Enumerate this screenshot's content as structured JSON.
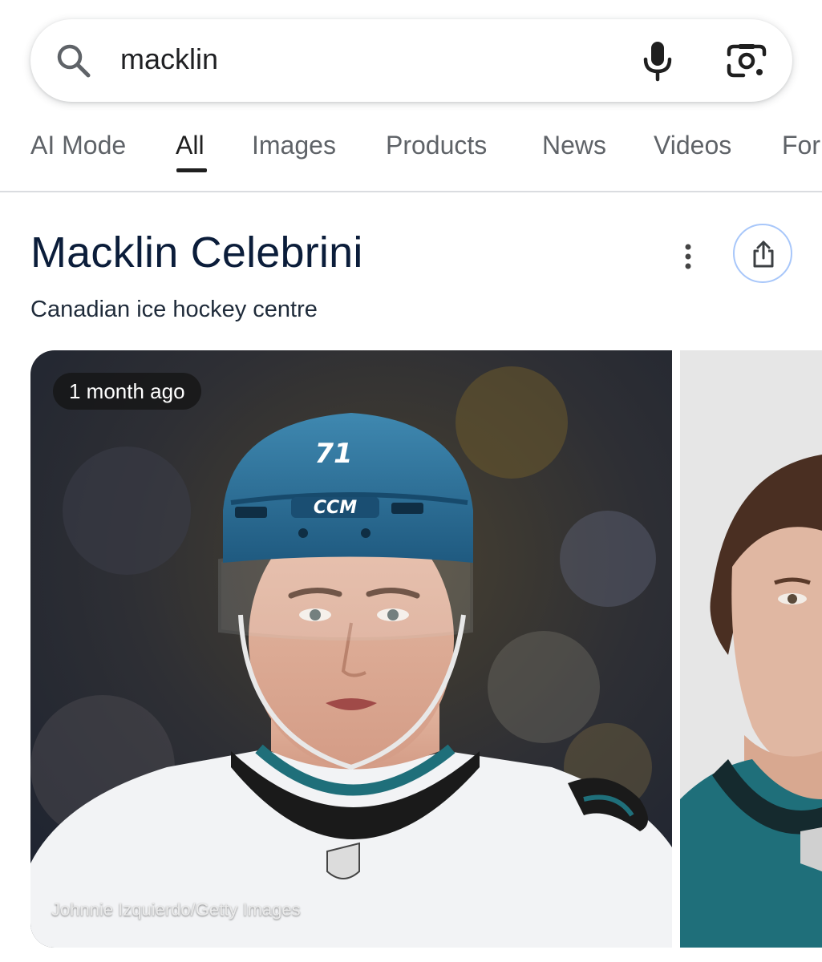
{
  "search": {
    "query": "macklin",
    "icons": [
      "search-icon",
      "mic-icon",
      "google-lens-icon"
    ]
  },
  "tabs": [
    {
      "label": "AI Mode",
      "active": false
    },
    {
      "label": "All",
      "active": true
    },
    {
      "label": "Images",
      "active": false
    },
    {
      "label": "Products",
      "active": false
    },
    {
      "label": "News",
      "active": false
    },
    {
      "label": "Videos",
      "active": false
    },
    {
      "label": "For",
      "active": false
    }
  ],
  "entity": {
    "title": "Macklin Celebrini",
    "subtitle": "Canadian ice hockey centre",
    "icons": [
      "more-vert-icon",
      "share-icon"
    ]
  },
  "images": [
    {
      "time_badge": "1 month ago",
      "credit": "Johnnie Izquierdo/Getty Images",
      "helmet_number": "71",
      "helmet_brand": "CCM"
    },
    {}
  ],
  "colors": {
    "accent_border": "#a8c7fa",
    "title": "#0b1d3a",
    "tab_inactive": "#5f6368",
    "jersey_teal": "#1f6f7a"
  }
}
